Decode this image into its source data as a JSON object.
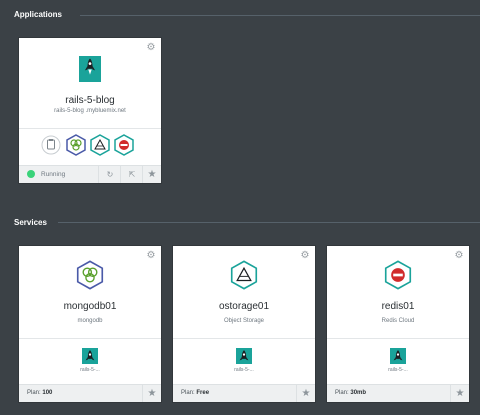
{
  "sections": {
    "applications": "Applications",
    "services": "Services"
  },
  "app": {
    "name": "rails-5-blog",
    "route": "rails-5-blog .mybluemix.net",
    "status": "Running",
    "bound_icons": [
      "clipboard-icon",
      "mongodb-icon",
      "object-storage-icon",
      "redis-icon"
    ]
  },
  "services": [
    {
      "name": "mongodb01",
      "type": "mongodb",
      "icon": "mongodb-icon",
      "bound_app": "rails-5-...",
      "plan_label": "Plan:",
      "plan": "100"
    },
    {
      "name": "ostorage01",
      "type": "Object Storage",
      "icon": "object-storage-icon",
      "bound_app": "rails-5-...",
      "plan_label": "Plan:",
      "plan": "Free"
    },
    {
      "name": "redis01",
      "type": "Redis Cloud",
      "icon": "redis-icon",
      "bound_app": "rails-5-...",
      "plan_label": "Plan:",
      "plan": "30mb"
    }
  ],
  "colors": {
    "background": "#3b4146",
    "teal": "#1aa39a",
    "mongo": "#5aa02c",
    "mongo_hex": "#4a5aa8",
    "redis": "#d12b2b",
    "running": "#3ad37a"
  }
}
